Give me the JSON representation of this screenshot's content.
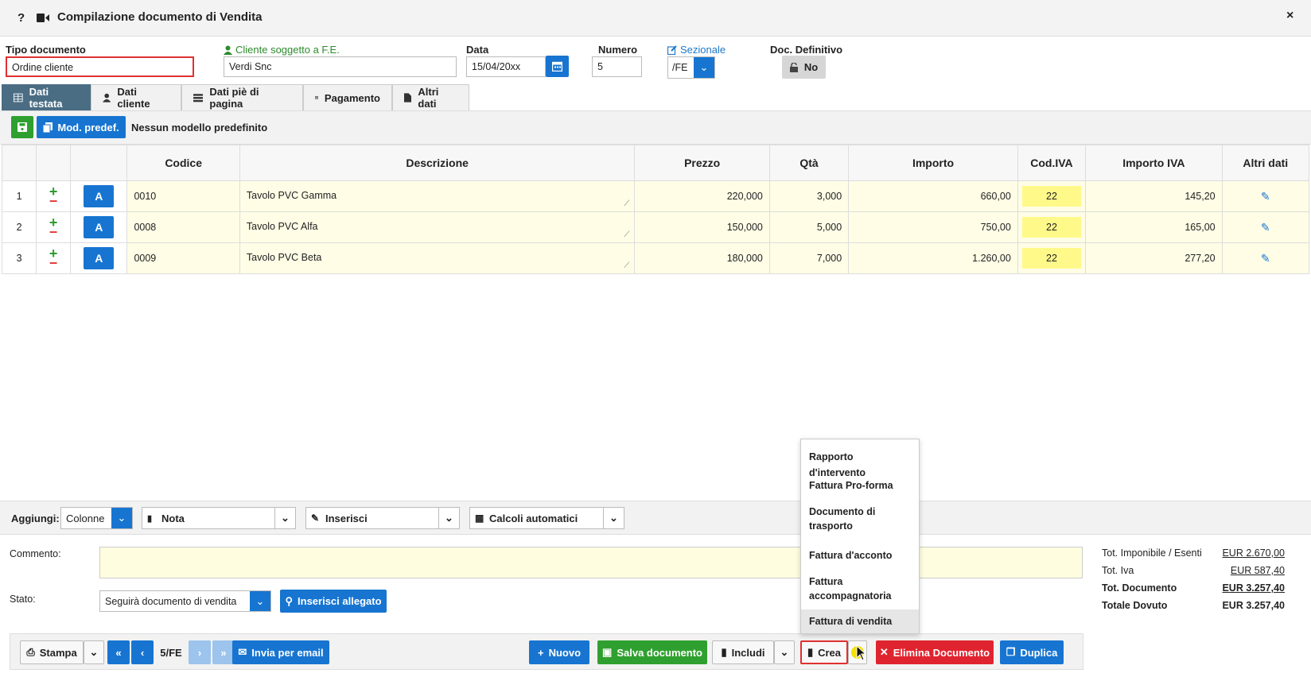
{
  "window": {
    "title": "Compilazione documento di Vendita",
    "help": "?",
    "close": "×"
  },
  "header": {
    "tipo_label": "Tipo documento",
    "tipo_value": "Ordine cliente",
    "cliente_label": "Cliente soggetto a F.E.",
    "cliente_value": "Verdi Snc",
    "data_label": "Data",
    "data_value": "15/04/20xx",
    "numero_label": "Numero",
    "numero_value": "5",
    "sezionale_label": "Sezionale",
    "sezionale_value": "/FE",
    "definitivo_label": "Doc. Definitivo",
    "definitivo_value": "No"
  },
  "tabs": [
    {
      "label": "Dati testata"
    },
    {
      "label": "Dati cliente"
    },
    {
      "label": "Dati piè di pagina"
    },
    {
      "label": "Pagamento"
    },
    {
      "label": "Altri dati"
    }
  ],
  "toolbar": {
    "mod_label": "Mod. predef.",
    "model_text": "Nessun modello predefinito"
  },
  "table": {
    "headers": [
      "Codice",
      "Descrizione",
      "Prezzo",
      "Qtà",
      "Importo",
      "Cod.IVA",
      "Importo IVA",
      "Altri dati"
    ],
    "rows": [
      {
        "n": "1",
        "a": "A",
        "codice": "0010",
        "descrizione": "Tavolo PVC Gamma",
        "prezzo": "220,000",
        "qta": "3,000",
        "importo": "660,00",
        "iva": "22",
        "importo_iva": "145,20"
      },
      {
        "n": "2",
        "a": "A",
        "codice": "0008",
        "descrizione": "Tavolo PVC Alfa",
        "prezzo": "150,000",
        "qta": "5,000",
        "importo": "750,00",
        "iva": "22",
        "importo_iva": "165,00"
      },
      {
        "n": "3",
        "a": "A",
        "codice": "0009",
        "descrizione": "Tavolo PVC Beta",
        "prezzo": "180,000",
        "qta": "7,000",
        "importo": "1.260,00",
        "iva": "22",
        "importo_iva": "277,20"
      }
    ]
  },
  "addbar": {
    "label": "Aggiungi:",
    "colonne": "Colonne",
    "nota": "Nota",
    "inserisci": "Inserisci",
    "calcoli": "Calcoli automatici"
  },
  "footer": {
    "commento_label": "Commento:",
    "stato_label": "Stato:",
    "stato_value": "Seguirà documento di vendita",
    "allegato": "Inserisci allegato",
    "totals": [
      {
        "label": "Tot. Imponibile / Esenti",
        "value": "EUR 2.670,00",
        "bold": false
      },
      {
        "label": "Tot. Iva",
        "value": "EUR 587,40",
        "bold": false
      },
      {
        "label": "Tot. Documento",
        "value": "EUR 3.257,40",
        "bold": true
      },
      {
        "label": "Totale Dovuto",
        "value": "EUR 3.257,40",
        "bold": true
      }
    ]
  },
  "bottom": {
    "stampa": "Stampa",
    "page": "5/FE",
    "email": "Invia per email",
    "nuovo": "Nuovo",
    "salva": "Salva documento",
    "includi": "Includi",
    "crea": "Crea",
    "elimina": "Elimina Documento",
    "duplica": "Duplica"
  },
  "menu": {
    "items": [
      "Rapporto d'intervento",
      "Fattura Pro-forma",
      "Documento di trasporto",
      "Fattura d'acconto",
      "Fattura accompagnatoria",
      "Fattura di vendita"
    ]
  }
}
